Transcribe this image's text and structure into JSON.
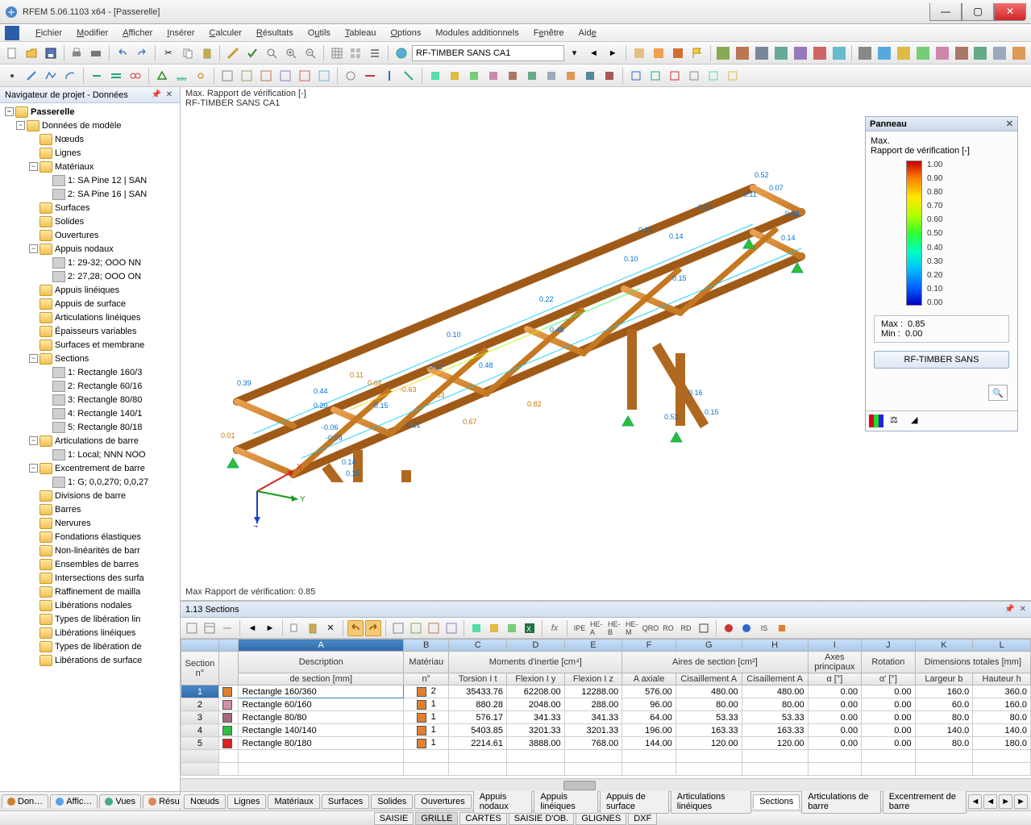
{
  "window": {
    "title": "RFEM 5.06.1103 x64 - [Passerelle]"
  },
  "menu": {
    "items": [
      "Fichier",
      "Modifier",
      "Afficher",
      "Insérer",
      "Calculer",
      "Résultats",
      "Outils",
      "Tableau",
      "Options",
      "Modules additionnels",
      "Fenêtre",
      "Aide"
    ]
  },
  "toolbar": {
    "dropdown_value": "RF-TIMBER SANS CA1"
  },
  "navigator": {
    "title": "Navigateur de projet - Données",
    "root": "Passerelle",
    "groups": [
      {
        "label": "Données de modèle",
        "children": [
          {
            "label": "Nœuds"
          },
          {
            "label": "Lignes"
          },
          {
            "label": "Matériaux",
            "children": [
              {
                "label": "1: SA Pine 12 | SAN"
              },
              {
                "label": "2: SA Pine 16 | SAN"
              }
            ]
          },
          {
            "label": "Surfaces"
          },
          {
            "label": "Solides"
          },
          {
            "label": "Ouvertures"
          },
          {
            "label": "Appuis nodaux",
            "children": [
              {
                "label": "1: 29-32; OOO NN"
              },
              {
                "label": "2: 27,28; OOO ON"
              }
            ]
          },
          {
            "label": "Appuis linéiques"
          },
          {
            "label": "Appuis de surface"
          },
          {
            "label": "Articulations linéiques"
          },
          {
            "label": "Épaisseurs variables"
          },
          {
            "label": "Surfaces et membrane"
          },
          {
            "label": "Sections",
            "children": [
              {
                "label": "1: Rectangle 160/3"
              },
              {
                "label": "2: Rectangle 60/16"
              },
              {
                "label": "3: Rectangle 80/80"
              },
              {
                "label": "4: Rectangle 140/1"
              },
              {
                "label": "5: Rectangle 80/18"
              }
            ]
          },
          {
            "label": "Articulations de barre",
            "children": [
              {
                "label": "1: Local; NNN NOO"
              }
            ]
          },
          {
            "label": "Excentrement de barre",
            "children": [
              {
                "label": "1: G; 0,0,270; 0,0,27"
              }
            ]
          },
          {
            "label": "Divisions de barre"
          },
          {
            "label": "Barres"
          },
          {
            "label": "Nervures"
          },
          {
            "label": "Fondations élastiques"
          },
          {
            "label": "Non-linéarités de barr"
          },
          {
            "label": "Ensembles de barres"
          },
          {
            "label": "Intersections des surfa"
          },
          {
            "label": "Raffinement de mailla"
          },
          {
            "label": "Libérations nodales"
          },
          {
            "label": "Types de libération lin"
          },
          {
            "label": "Libérations linéiques"
          },
          {
            "label": "Types de libération de"
          },
          {
            "label": "Libérations de surface"
          }
        ]
      }
    ],
    "tabs": [
      "Don…",
      "Affic…",
      "Vues",
      "Résu…"
    ]
  },
  "viewport": {
    "line1": "Max. Rapport de vérification [-]",
    "line2": "RF-TIMBER SANS CA1",
    "footer": "Max Rapport de vérification: 0.85"
  },
  "panel": {
    "title": "Panneau",
    "label1": "Max.",
    "label2": "Rapport de vérification [-]",
    "ramp_values": [
      "1.00",
      "0.90",
      "0.80",
      "0.70",
      "0.60",
      "0.50",
      "0.40",
      "0.30",
      "0.20",
      "0.10",
      "0.00"
    ],
    "max_label": "Max  :",
    "max_value": "0.85",
    "min_label": "Min   :",
    "min_value": "0.00",
    "button": "RF-TIMBER SANS"
  },
  "sections": {
    "title": "1.13 Sections",
    "col_letters": [
      "",
      "A",
      "B",
      "C",
      "D",
      "E",
      "F",
      "G",
      "H",
      "I",
      "J",
      "K",
      "L"
    ],
    "group_row": {
      "section": "Section",
      "description": "Description",
      "materiau": "Matériau",
      "moments": "Moments d'inertie [cm⁴]",
      "aires": "Aires de section [cm²]",
      "axes": "Axes principaux",
      "rotation": "Rotation",
      "dimensions": "Dimensions totales [mm]"
    },
    "sub_row": {
      "n": "n°",
      "desc": "de section [mm]",
      "mat_n": "n°",
      "torsion": "Torsion I t",
      "flexion_y": "Flexion I y",
      "flexion_z": "Flexion I z",
      "a": "A axiale",
      "cis_a": "Cisaillement A",
      "cis_b": "Cisaillement A",
      "alpha": "α [°]",
      "alpha2": "α' [°]",
      "largeur": "Largeur b",
      "hauteur": "Hauteur h"
    },
    "rows": [
      {
        "n": "1",
        "sw": "#e08030",
        "desc": "Rectangle 160/360",
        "mat_sw": "#e08030",
        "mat": "2",
        "it": "35433.76",
        "iy": "62208.00",
        "iz": "12288.00",
        "a": "576.00",
        "ca": "480.00",
        "cb": "480.00",
        "ax": "0.00",
        "rot": "0.00",
        "b": "160.0",
        "h": "360.0",
        "sel": true
      },
      {
        "n": "2",
        "sw": "#d090a0",
        "desc": "Rectangle 60/160",
        "mat_sw": "#e08030",
        "mat": "1",
        "it": "880.28",
        "iy": "2048.00",
        "iz": "288.00",
        "a": "96.00",
        "ca": "80.00",
        "cb": "80.00",
        "ax": "0.00",
        "rot": "0.00",
        "b": "60.0",
        "h": "160.0"
      },
      {
        "n": "3",
        "sw": "#a06878",
        "desc": "Rectangle 80/80",
        "mat_sw": "#e08030",
        "mat": "1",
        "it": "576.17",
        "iy": "341.33",
        "iz": "341.33",
        "a": "64.00",
        "ca": "53.33",
        "cb": "53.33",
        "ax": "0.00",
        "rot": "0.00",
        "b": "80.0",
        "h": "80.0"
      },
      {
        "n": "4",
        "sw": "#30c040",
        "desc": "Rectangle 140/140",
        "mat_sw": "#e08030",
        "mat": "1",
        "it": "5403.85",
        "iy": "3201.33",
        "iz": "3201.33",
        "a": "196.00",
        "ca": "163.33",
        "cb": "163.33",
        "ax": "0.00",
        "rot": "0.00",
        "b": "140.0",
        "h": "140.0"
      },
      {
        "n": "5",
        "sw": "#e02020",
        "desc": "Rectangle 80/180",
        "mat_sw": "#e08030",
        "mat": "1",
        "it": "2214.61",
        "iy": "3888.00",
        "iz": "768.00",
        "a": "144.00",
        "ca": "120.00",
        "cb": "120.00",
        "ax": "0.00",
        "rot": "0.00",
        "b": "80.0",
        "h": "180.0"
      }
    ]
  },
  "bottom_tabs": [
    "Nœuds",
    "Lignes",
    "Matériaux",
    "Surfaces",
    "Solides",
    "Ouvertures",
    "Appuis nodaux",
    "Appuis linéiques",
    "Appuis de surface",
    "Articulations linéiques",
    "Sections",
    "Articulations de barre",
    "Excentrement de barre"
  ],
  "bottom_tabs_active": "Sections",
  "status_tabs": [
    "SAISIE",
    "GRILLE",
    "CARTES",
    "SAISIE D'OB.",
    "GLIGNES",
    "DXF"
  ],
  "status_active": "GRILLE"
}
